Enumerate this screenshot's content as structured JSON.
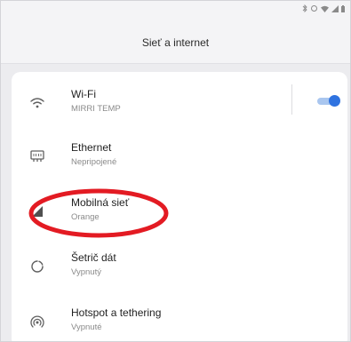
{
  "header": {
    "title": "Sieť a internet"
  },
  "status_icons": [
    "bluetooth-icon",
    "rotate-icon",
    "wifi-icon",
    "signal-icon",
    "battery-icon"
  ],
  "rows": [
    {
      "title": "Wi-Fi",
      "subtitle": "MIRRI TEMP",
      "icon": "wifi-icon",
      "toggle_on": true
    },
    {
      "title": "Ethernet",
      "subtitle": "Nepripojené",
      "icon": "ethernet-icon"
    },
    {
      "title": "Mobilná sieť",
      "subtitle": "Orange",
      "icon": "cell-signal-icon"
    },
    {
      "title": "Šetrič dát",
      "subtitle": "Vypnutý",
      "icon": "data-saver-icon"
    },
    {
      "title": "Hotspot a tethering",
      "subtitle": "Vypnuté",
      "icon": "hotspot-icon"
    }
  ],
  "colors": {
    "accent": "#2f73e0",
    "annotation": "#e31b23",
    "background": "#ececef",
    "card": "#ffffff"
  }
}
